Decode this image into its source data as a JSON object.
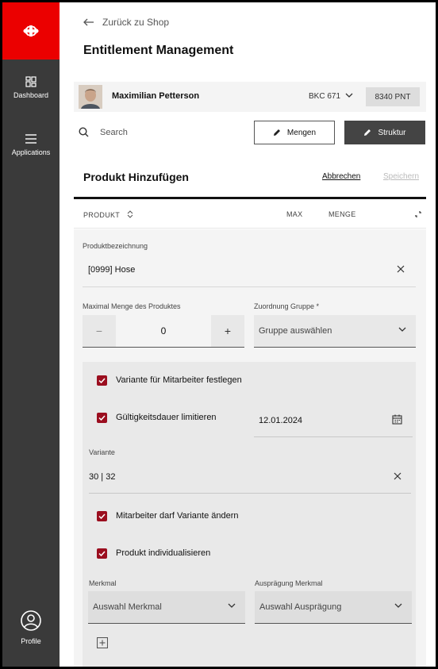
{
  "sidebar": {
    "logo_icon": "sbb-logo-icon",
    "brand_color": "#eb0000",
    "items": [
      {
        "label": "Dashboard",
        "icon": "dashboard-icon"
      },
      {
        "label": "Applications",
        "icon": "menu-icon"
      }
    ],
    "profile_label": "Profile"
  },
  "header": {
    "back_label": "Zurück zu Shop",
    "title": "Entitlement Management"
  },
  "user": {
    "name": "Maximilian Petterson",
    "code": "BKC 671",
    "points": "8340 PNT"
  },
  "toolbar": {
    "search_placeholder": "Search",
    "mengen_label": "Mengen",
    "struktur_label": "Struktur"
  },
  "section": {
    "title": "Produkt Hinzufügen",
    "cancel_label": "Abbrechen",
    "save_label": "Speichern"
  },
  "table": {
    "col_produkt": "PRODUKT",
    "col_max": "MAX",
    "col_menge": "MENGE"
  },
  "form": {
    "product_label": "Produktbezeichnung",
    "product_value": "[0999]  Hose",
    "max_qty_label": "Maximal Menge des Produktes",
    "max_qty_value": "0",
    "minus": "−",
    "plus": "+",
    "group_label": "Zuordnung Gruppe *",
    "group_placeholder": "Gruppe auswählen",
    "cb_variant_label": "Variante für Mitarbeiter festlegen",
    "cb_validity_label": "Gültigkeitsdauer limitieren",
    "validity_date": "12.01.2024",
    "variant_label": "Variante",
    "variant_value": "30 | 32",
    "cb_change_label": "Mitarbeiter darf Variante ändern",
    "cb_individual_label": "Produkt  individualisieren",
    "feature_label": "Merkmal",
    "feature_placeholder": "Auswahl Merkmal",
    "expression_label": "Ausprägung Merkmal",
    "expression_placeholder": "Auswahl Ausprägung"
  },
  "colors": {
    "checkbox": "#9b0e1f",
    "sidebar": "#3a3a3a",
    "dark_button": "#444444"
  }
}
